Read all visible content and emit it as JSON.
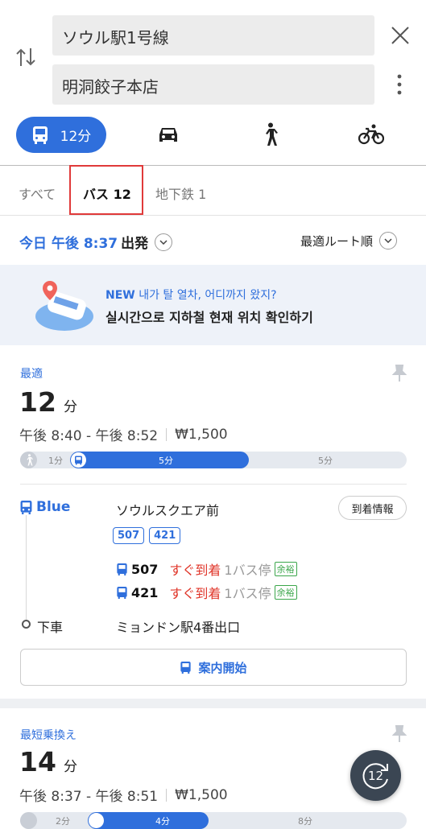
{
  "search": {
    "origin": "ソウル駅1号線",
    "destination": "明洞餃子本店"
  },
  "modes": {
    "bus_time": "12分"
  },
  "filters": {
    "all": "すべて",
    "bus": "バス 12",
    "subway": "地下鉄 1"
  },
  "departure": {
    "time_label": "今日 午後 8:37",
    "suffix": "出発",
    "sort": "最適ルート順"
  },
  "banner": {
    "new": "NEW",
    "headline": "내가 탈 열차, 어디까지 왔지?",
    "subline": "실시간으로 지하철 현재 위치 확인하기"
  },
  "route1": {
    "tag": "最適",
    "minutes": "12",
    "unit": "分",
    "time_range": "午後 8:40 - 午後 8:52",
    "fare": "₩1,500",
    "segments": [
      {
        "label": "1分",
        "fraction": 0.09
      },
      {
        "label": "5分",
        "fraction": 0.41
      },
      {
        "label": "5分",
        "fraction": 0.41
      }
    ],
    "board": {
      "line": "Blue",
      "stop": "ソウルスクエア前",
      "arrival_button": "到着情報",
      "routes": [
        "507",
        "421"
      ],
      "arrivals": [
        {
          "bus": "507",
          "status": "すぐ到着",
          "stops": "1バス停",
          "crowd": "余裕"
        },
        {
          "bus": "421",
          "status": "すぐ到着",
          "stops": "1バス停",
          "crowd": "余裕"
        }
      ]
    },
    "alight": {
      "label": "下車",
      "stop": "ミョンドン駅4番出口"
    },
    "guide": "案内開始"
  },
  "route2": {
    "tag": "最短乗換え",
    "minutes": "14",
    "unit": "分",
    "time_range": "午後 8:37 - 午後 8:51",
    "fare": "₩1,500",
    "segments": [
      {
        "label": "2分"
      },
      {
        "label": "4分"
      },
      {
        "label": "8分"
      }
    ]
  },
  "fab": {
    "label": "12"
  },
  "colors": {
    "accent": "#2f6fdc",
    "arrive": "#e0362a",
    "crowd": "#3aa64a"
  }
}
